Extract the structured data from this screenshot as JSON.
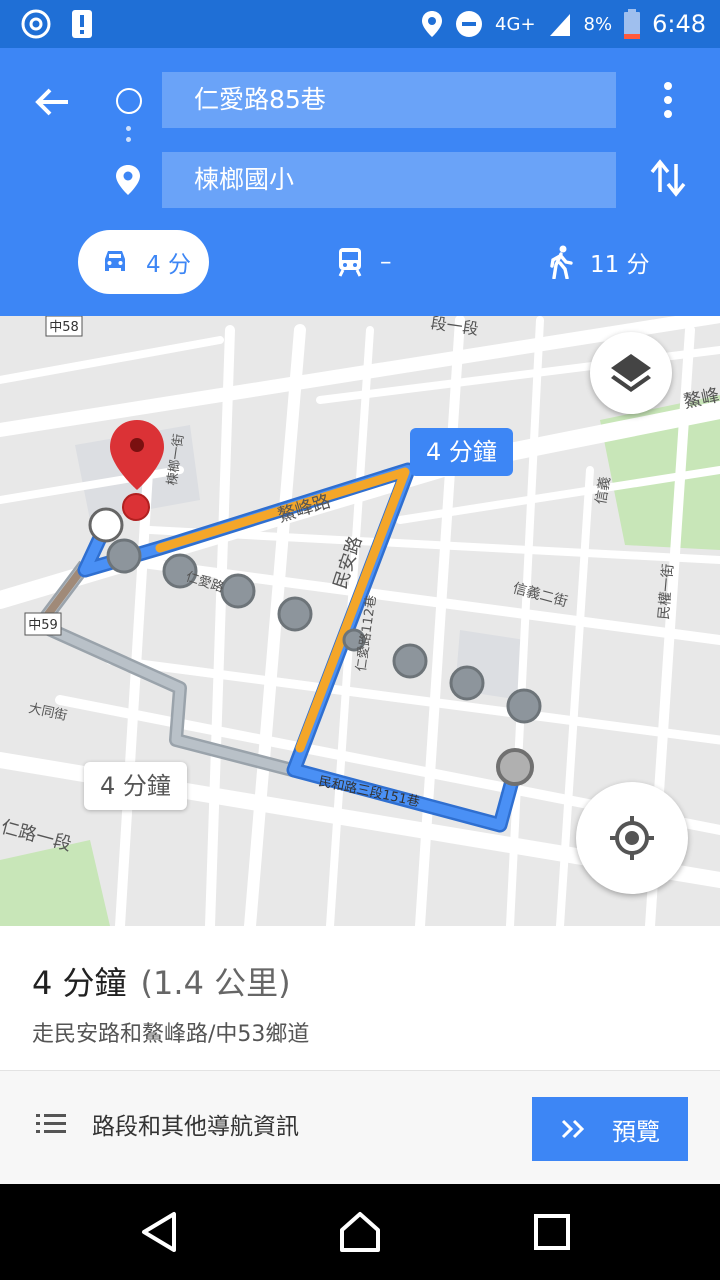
{
  "status_bar": {
    "network": "4G+",
    "battery": "8%",
    "time": "6:48"
  },
  "search": {
    "origin": "仁愛路85巷",
    "destination": "楝榔國小"
  },
  "modes": {
    "drive": "4 分",
    "transit": "–",
    "walk": "11 分"
  },
  "map": {
    "primary_time": "4 分鐘",
    "alt_time": "4 分鐘",
    "labels": {
      "zhong58": "中58",
      "zhong59": "中59",
      "aofeng_rd": "鰲峰路",
      "aofeng_top": "鰲峰",
      "minan_rd": "民安路",
      "renai_lane112": "仁愛路112巷",
      "renai_rd": "仁愛路",
      "xinyi_2nd": "信義二街",
      "xinyi": "信義",
      "minquan_1st": "民權一街",
      "datong_st": "大同街",
      "minhe_lane151": "民和路三段151巷",
      "lianlang_1st": "楝榔一街",
      "seg1_top": "段一段",
      "renai_seg1": "仁路一段"
    }
  },
  "route_summary": {
    "duration": "4 分鐘",
    "distance": "(1.4 公里)",
    "via": "走民安路和鰲峰路/中53鄉道"
  },
  "actions": {
    "steps": "路段和其他導航資訊",
    "preview": "預覽"
  },
  "colors": {
    "header": "#3d86f5",
    "status": "#1f6fd6",
    "route": "#3d86f5",
    "traffic": "#f4a629",
    "pin": "#db3236"
  }
}
